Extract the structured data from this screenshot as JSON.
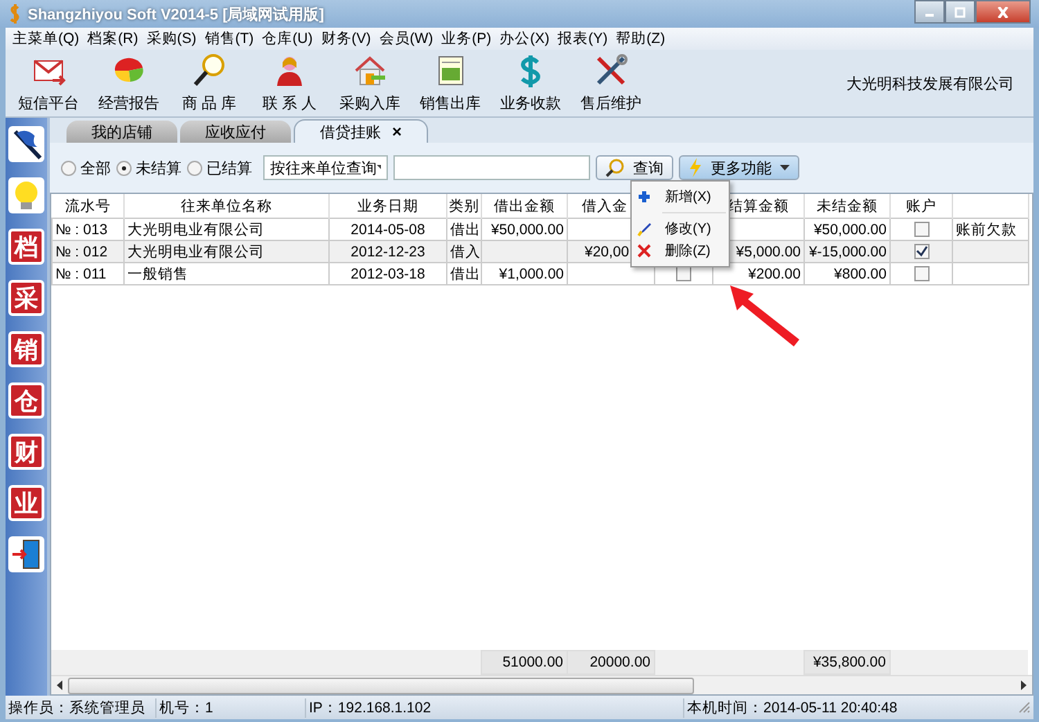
{
  "window": {
    "title": "Shangzhiyou Soft V2014-5 [局域网试用版]"
  },
  "menu": [
    "主菜单(Q)",
    "档案(R)",
    "采购(S)",
    "销售(T)",
    "仓库(U)",
    "财务(V)",
    "会员(W)",
    "业务(P)",
    "办公(X)",
    "报表(Y)",
    "帮助(Z)"
  ],
  "toolbar": [
    "短信平台",
    "经营报告",
    "商 品 库",
    "联 系 人",
    "采购入库",
    "销售出库",
    "业务收款",
    "售后维护"
  ],
  "company": "大光明科技发展有限公司",
  "sidebar": [
    {
      "kind": "flag"
    },
    {
      "kind": "bulb"
    },
    {
      "kind": "seal",
      "label": "档"
    },
    {
      "kind": "seal",
      "label": "采"
    },
    {
      "kind": "seal",
      "label": "销"
    },
    {
      "kind": "seal",
      "label": "仓"
    },
    {
      "kind": "seal",
      "label": "财"
    },
    {
      "kind": "seal",
      "label": "业"
    },
    {
      "kind": "exit"
    }
  ],
  "tabs": [
    {
      "label": "我的店铺",
      "selected": false
    },
    {
      "label": "应收应付",
      "selected": false
    },
    {
      "label": "借贷挂账",
      "selected": true,
      "close": "×"
    }
  ],
  "filter": {
    "radios": [
      {
        "label": "全部",
        "selected": false
      },
      {
        "label": "未结算",
        "selected": true
      },
      {
        "label": "已结算",
        "selected": false
      }
    ],
    "mode": "按往来单位查询",
    "query_button": "查询",
    "more_button": "更多功能"
  },
  "popup_menu": [
    {
      "label": "新增(X)"
    },
    {
      "label": "修改(Y)"
    },
    {
      "label": "删除(Z)"
    }
  ],
  "table": {
    "columns": [
      "流水号",
      "往来单位名称",
      "业务日期",
      "类别",
      "借出金额",
      "借入金",
      null,
      "结算金额",
      "未结金额",
      "账户",
      null
    ],
    "rows": [
      {
        "cells": [
          "№ : 013",
          "大光明电业有限公司",
          "2014-05-08",
          "借出",
          "¥50,000.00",
          null,
          null,
          null,
          "¥50,000.00",
          null,
          "账前欠款"
        ],
        "account_checked": false
      },
      {
        "cells": [
          "№ : 012",
          "大光明电业有限公司",
          "2012-12-23",
          "借入",
          null,
          "¥20,00",
          null,
          "¥5,000.00",
          "¥-15,000.00",
          null,
          null
        ],
        "account_checked": true
      },
      {
        "cells": [
          "№ : 011",
          "一般销售",
          "2012-03-18",
          "借出",
          "¥1,000.00",
          null,
          null,
          "¥200.00",
          "¥800.00",
          null,
          null
        ],
        "account_checked": false,
        "mid_checked": false
      }
    ],
    "totals": {
      "lent": "51000.00",
      "borrowed": "20000.00",
      "unsettled": "¥35,800.00"
    }
  },
  "status_bar": [
    "操作员：系统管理员",
    "机号：1",
    "IP：192.168.1.102",
    "本机时间：2014-05-11 20:40:48"
  ]
}
